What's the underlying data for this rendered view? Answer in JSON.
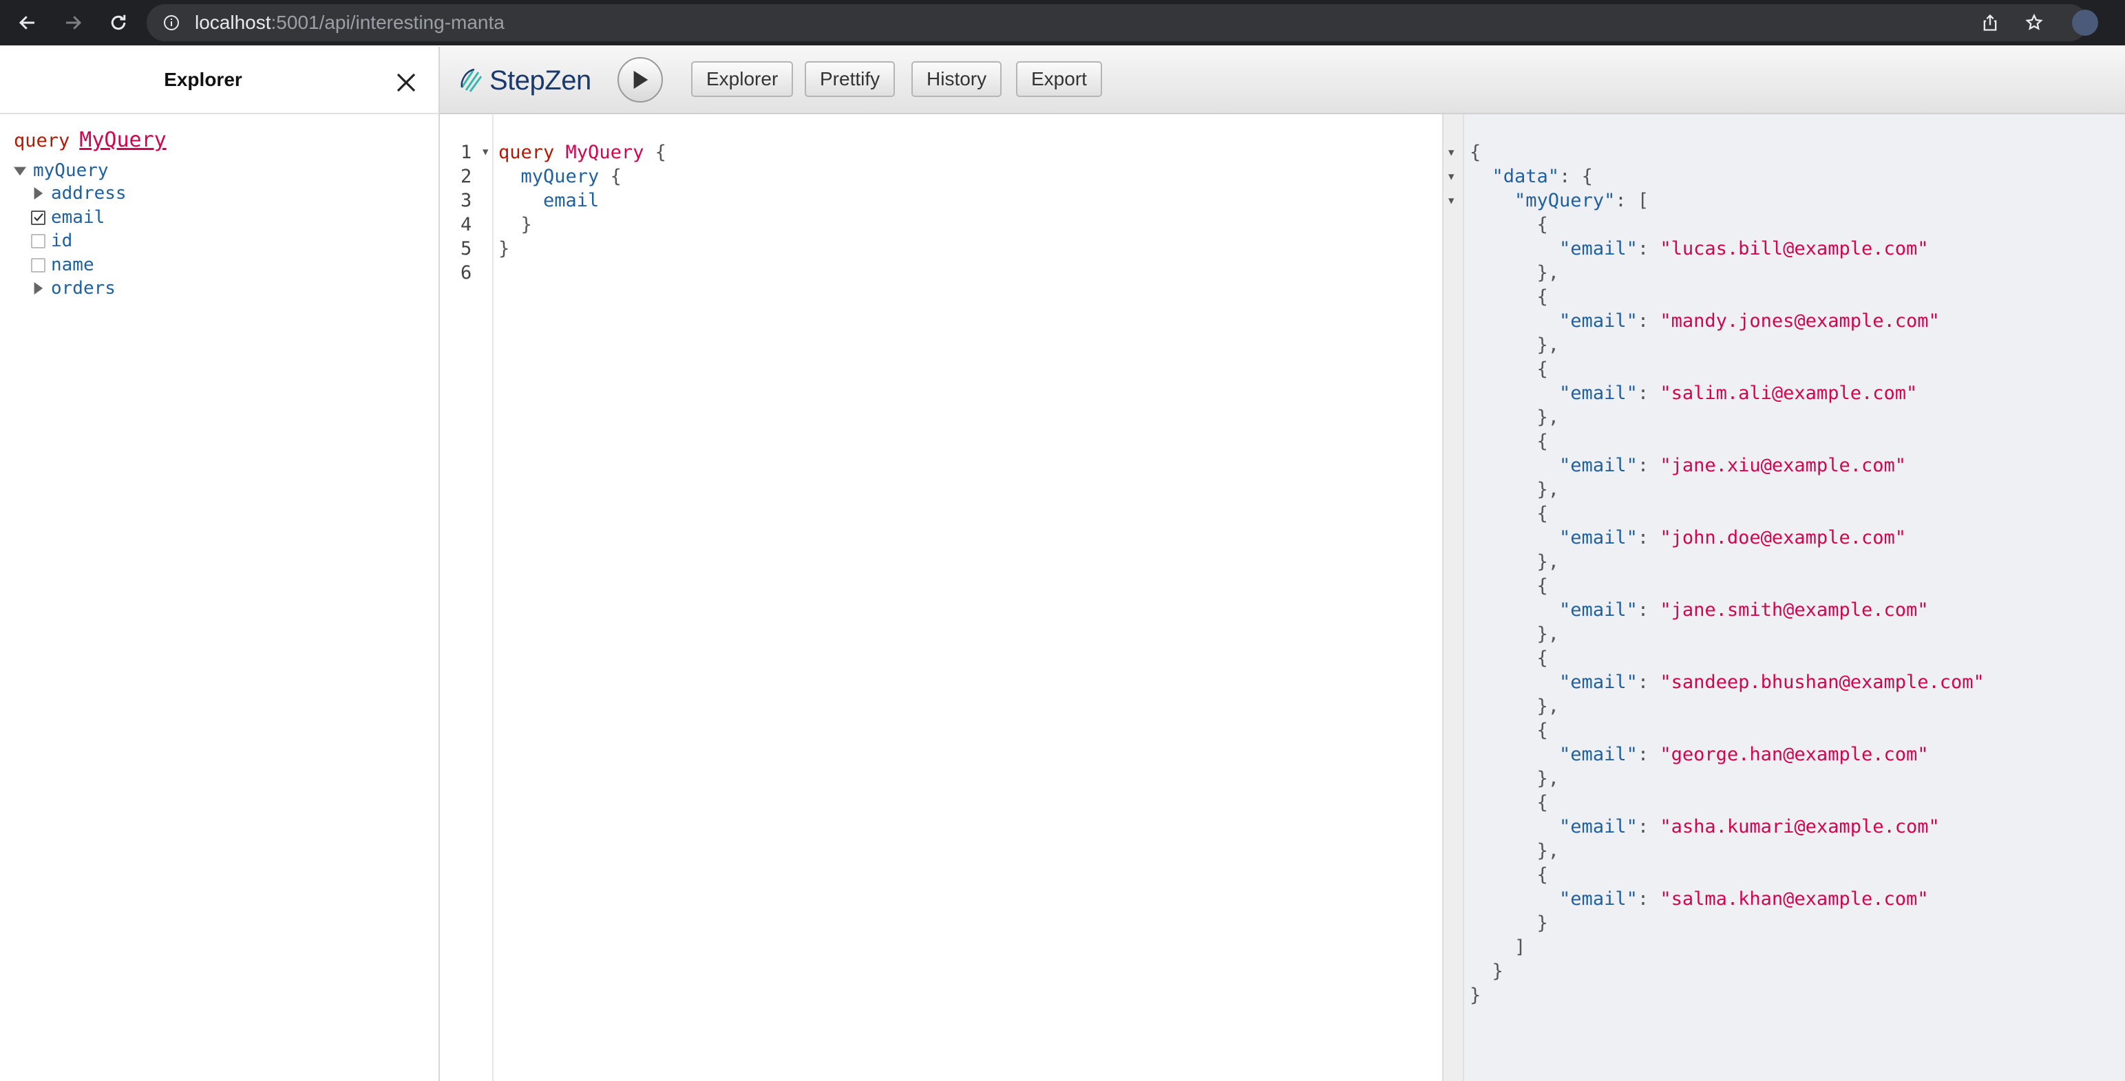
{
  "browser": {
    "url_host": "localhost",
    "url_path": ":5001/api/interesting-manta"
  },
  "explorer": {
    "title": "Explorer",
    "query_keyword": "query",
    "operation_name": "MyQuery",
    "root_field": "myQuery",
    "fields": [
      {
        "name": "address",
        "kind": "expandable"
      },
      {
        "name": "email",
        "kind": "checkbox",
        "checked": true
      },
      {
        "name": "id",
        "kind": "checkbox",
        "checked": false
      },
      {
        "name": "name",
        "kind": "checkbox",
        "checked": false
      },
      {
        "name": "orders",
        "kind": "expandable"
      }
    ]
  },
  "toolbar": {
    "logo_text": "StepZen",
    "buttons": [
      "Explorer",
      "Prettify",
      "History",
      "Export"
    ]
  },
  "editor": {
    "line_numbers": [
      "1",
      "2",
      "3",
      "4",
      "5",
      "6"
    ],
    "query_keyword": "query",
    "operation_name": "MyQuery",
    "open_brace": "{",
    "close_brace": "}",
    "root_field": "myQuery",
    "field": "email"
  },
  "result": {
    "data_key": "\"data\"",
    "root_key": "\"myQuery\"",
    "item_key": "\"email\"",
    "emails": [
      "\"lucas.bill@example.com\"",
      "\"mandy.jones@example.com\"",
      "\"salim.ali@example.com\"",
      "\"jane.xiu@example.com\"",
      "\"john.doe@example.com\"",
      "\"jane.smith@example.com\"",
      "\"sandeep.bhushan@example.com\"",
      "\"george.han@example.com\"",
      "\"asha.kumari@example.com\"",
      "\"salma.khan@example.com\""
    ]
  },
  "colors": {
    "keyword": "#b11a04",
    "operation_name": "#d2054e",
    "field": "#1f61a0",
    "string": "#d2054e"
  }
}
